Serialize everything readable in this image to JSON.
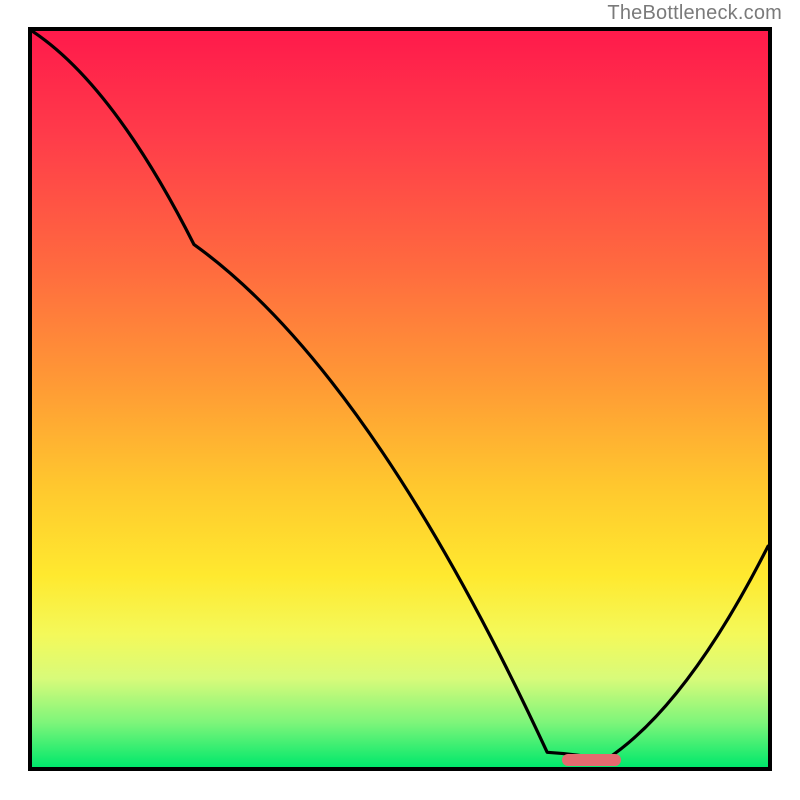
{
  "watermark": "TheBottleneck.com",
  "colors": {
    "gradient_top": "#ff1a4b",
    "gradient_mid1": "#ff9a35",
    "gradient_mid2": "#ffe92f",
    "gradient_bottom": "#00e86b",
    "curve": "#000000",
    "marker": "#e46a6f",
    "frame": "#000000"
  },
  "chart_data": {
    "type": "line",
    "title": "",
    "xlabel": "",
    "ylabel": "",
    "xlim": [
      0,
      100
    ],
    "ylim": [
      0,
      100
    ],
    "grid": false,
    "legend": false,
    "curve": [
      {
        "x": 0,
        "y": 100
      },
      {
        "x": 22,
        "y": 71
      },
      {
        "x": 70,
        "y": 2
      },
      {
        "x": 78,
        "y": 1
      },
      {
        "x": 100,
        "y": 30
      }
    ],
    "marker_range": {
      "x_start": 72,
      "x_end": 80,
      "y": 1
    },
    "note": "x is relative position (0=left,100=right); y is bottleneck % (0 at bottom = optimal, 100 at top)."
  }
}
